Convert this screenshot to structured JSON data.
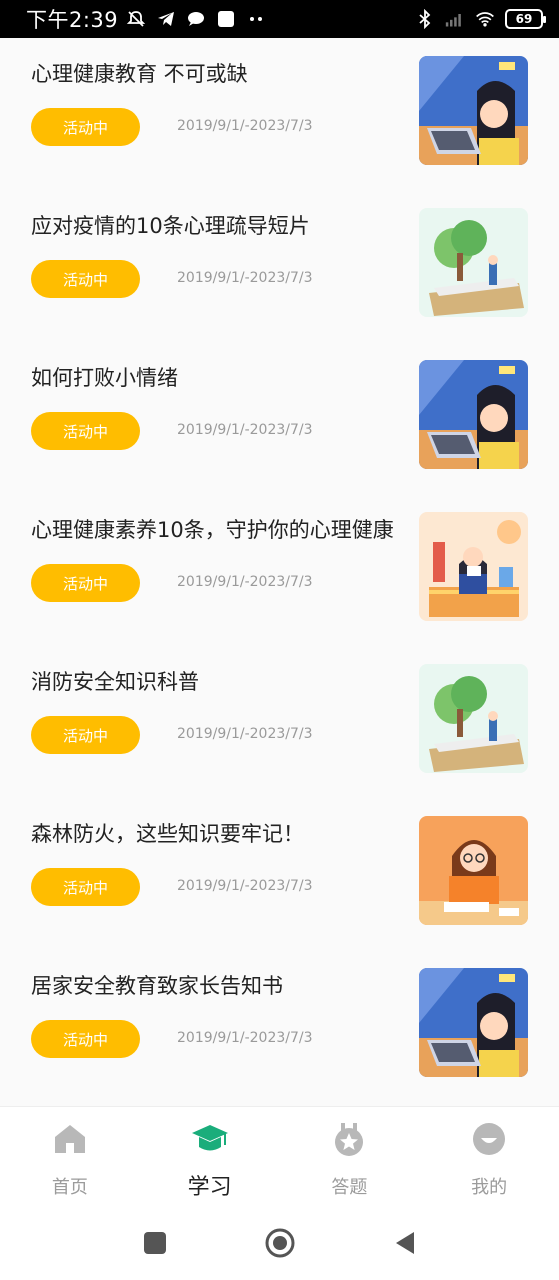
{
  "status_bar": {
    "time": "下午2:39",
    "battery": "69"
  },
  "items": [
    {
      "title": "心理健康教育 不可或缺",
      "badge": "活动中",
      "date": "2019/9/1/-2023/7/3",
      "thumb": "girl-laptop"
    },
    {
      "title": "应对疫情的10条心理疏导短片",
      "badge": "活动中",
      "date": "2019/9/1/-2023/7/3",
      "thumb": "tree-book"
    },
    {
      "title": "如何打败小情绪",
      "badge": "活动中",
      "date": "2019/9/1/-2023/7/3",
      "thumb": "girl-laptop"
    },
    {
      "title": "心理健康素养10条，守护你的心理健康",
      "badge": "活动中",
      "date": "2019/9/1/-2023/7/3",
      "thumb": "girl-reading"
    },
    {
      "title": "消防安全知识科普",
      "badge": "活动中",
      "date": "2019/9/1/-2023/7/3",
      "thumb": "tree-book"
    },
    {
      "title": "森林防火，这些知识要牢记！",
      "badge": "活动中",
      "date": "2019/9/1/-2023/7/3",
      "thumb": "girl-desk"
    },
    {
      "title": "居家安全教育致家长告知书",
      "badge": "活动中",
      "date": "2019/9/1/-2023/7/3",
      "thumb": "girl-laptop"
    }
  ],
  "tabs": [
    {
      "label": "首页",
      "icon": "home-icon"
    },
    {
      "label": "学习",
      "icon": "graduation-cap-icon"
    },
    {
      "label": "答题",
      "icon": "medal-icon"
    },
    {
      "label": "我的",
      "icon": "profile-icon"
    }
  ],
  "colors": {
    "accent": "#ffbd00",
    "active_tab": "#1aad7b",
    "inactive_tab": "#b8b8b8"
  }
}
